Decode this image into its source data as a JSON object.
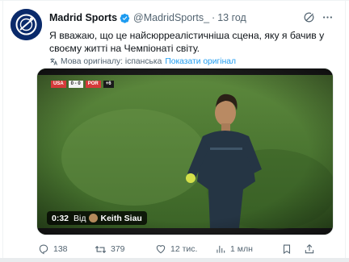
{
  "tweet": {
    "author_name": "Madrid Sports",
    "handle": "@MadridSports_",
    "separator": "·",
    "time": "13 год",
    "text": "Я вважаю, що це найсюрреалістичніша сцена, яку я бачив у своєму житті на Чемпіонаті світу.",
    "translation_note": "Мова оригіналу: іспанська",
    "show_original": "Показати оригінал"
  },
  "media": {
    "duration": "0:32",
    "from_label": "Від",
    "from_user": "Keith Siau",
    "scoreboard": {
      "team_left": "USA",
      "score": "0 - 0",
      "team_right": "POR",
      "extra": "+6"
    }
  },
  "actions": {
    "replies": "138",
    "retweets": "379",
    "likes": "12 тис.",
    "views": "1 млн"
  },
  "colors": {
    "accent": "#1d9bf0",
    "secondary_text": "#536471",
    "avatar_bg": "#0a2a6b"
  },
  "icons": {
    "verified": "verified-badge-icon",
    "grok": "grok-icon",
    "more": "more-icon",
    "translate": "translate-icon",
    "reply": "reply-icon",
    "retweet": "retweet-icon",
    "like": "heart-icon",
    "views": "views-icon",
    "bookmark": "bookmark-icon",
    "share": "share-icon"
  }
}
